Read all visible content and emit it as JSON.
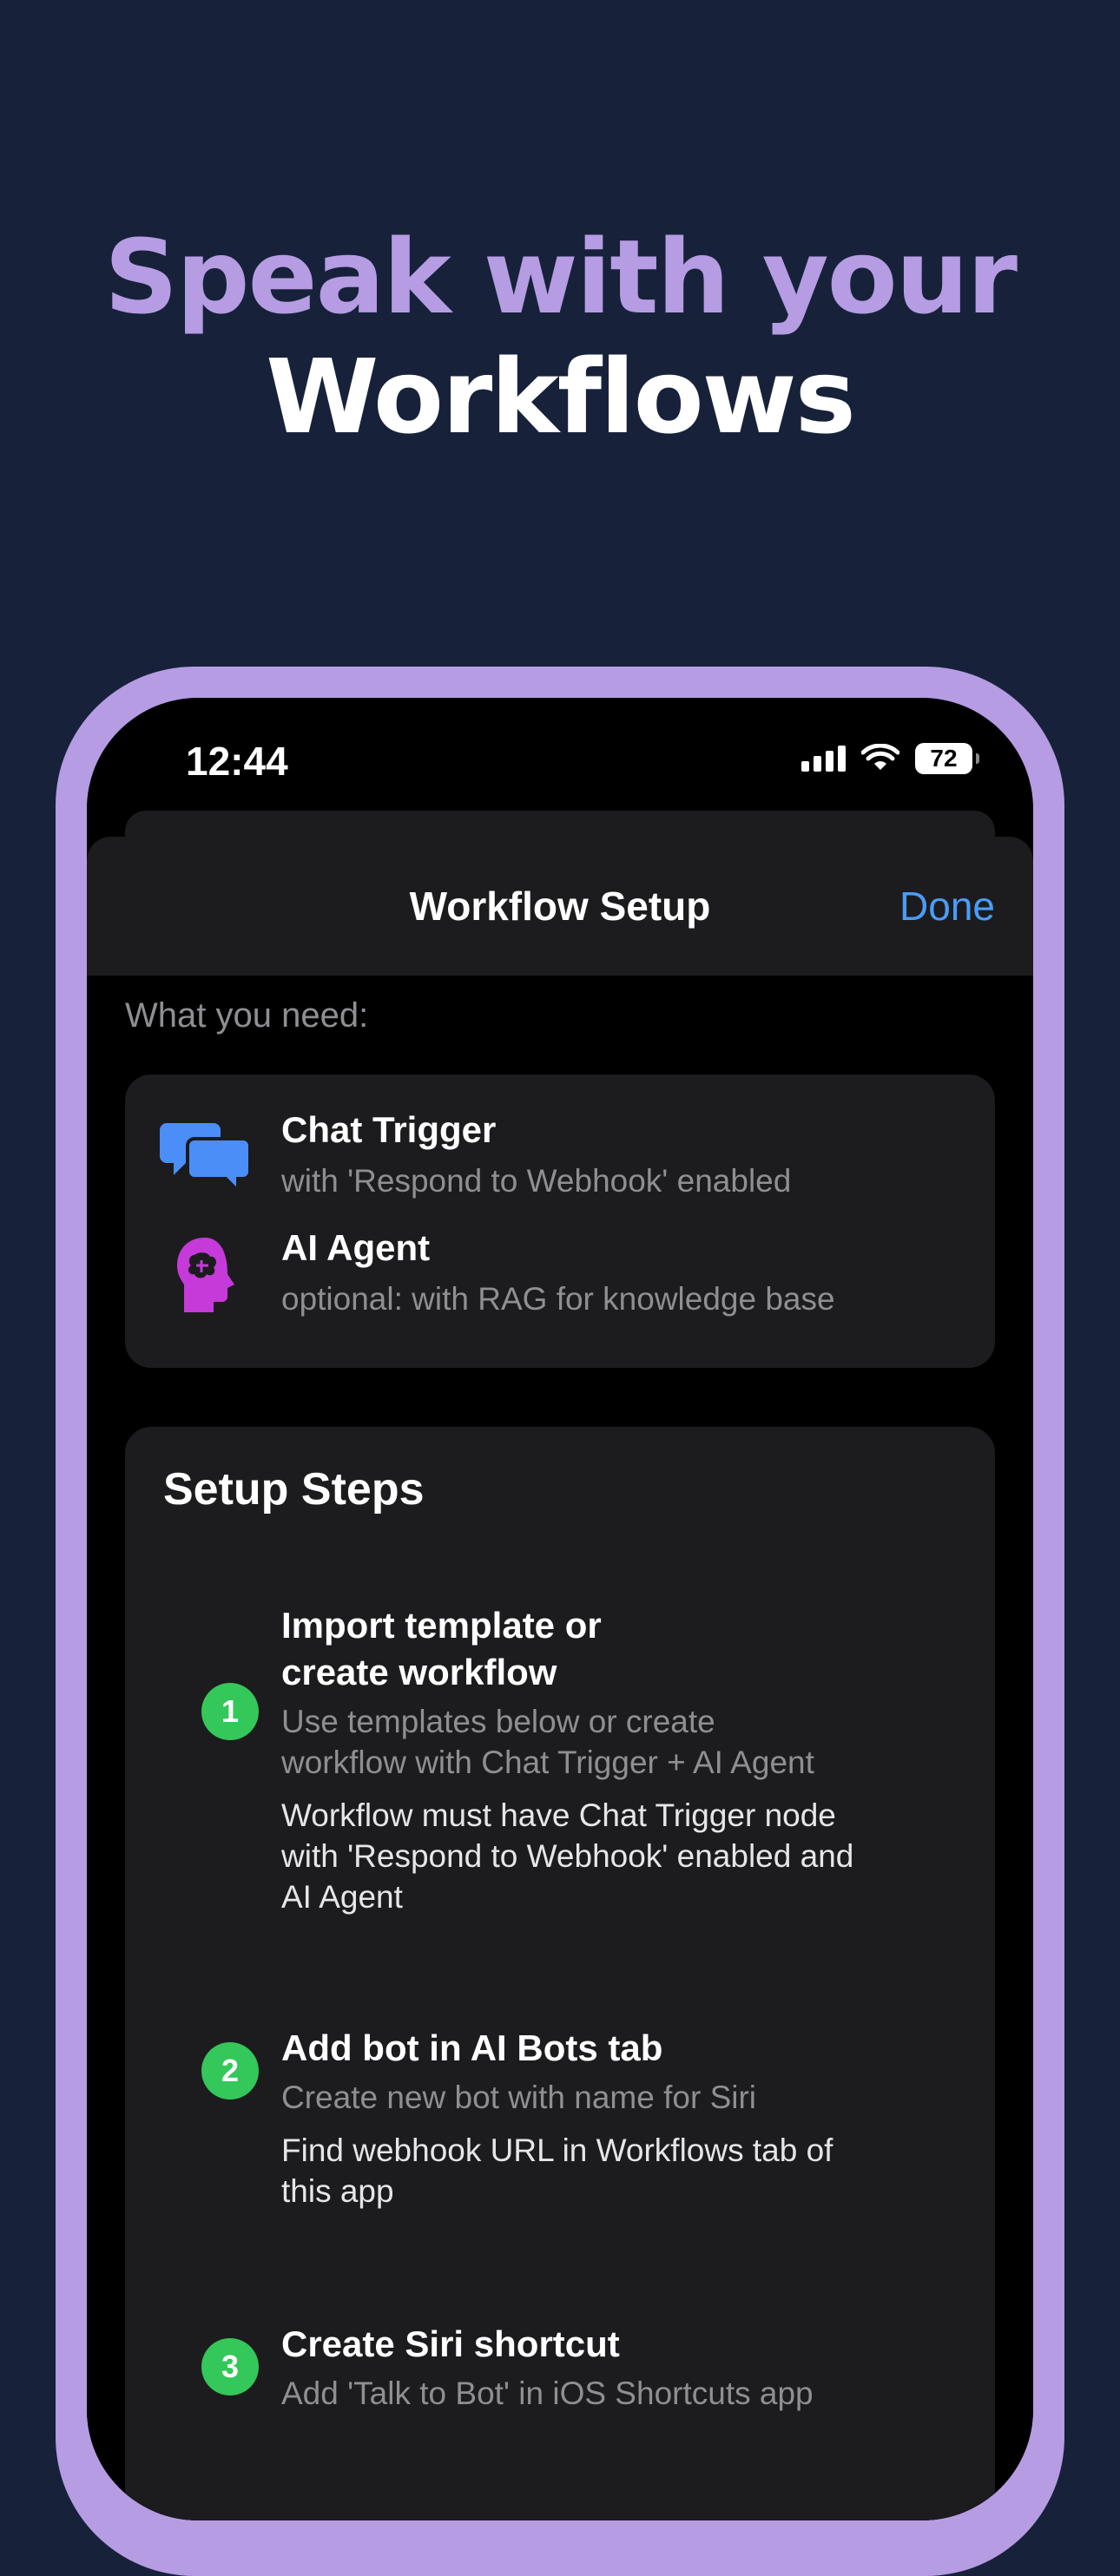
{
  "headline": {
    "line1": "Speak with your",
    "line2": "Workflows"
  },
  "status_bar": {
    "time": "12:44",
    "battery": "72"
  },
  "nav": {
    "title": "Workflow Setup",
    "done_label": "Done"
  },
  "requirements": {
    "header": "What you need:",
    "items": [
      {
        "icon": "chat-bubbles-icon",
        "title": "Chat Trigger",
        "subtitle": "with 'Respond to Webhook' enabled"
      },
      {
        "icon": "brain-head-icon",
        "title": "AI Agent",
        "subtitle": "optional: with RAG for knowledge base"
      }
    ]
  },
  "setup": {
    "title": "Setup Steps",
    "steps": [
      {
        "number": "1",
        "title": "Import template or\ncreate workflow",
        "subtitle": "Use templates below or create\nworkflow with Chat Trigger + AI Agent",
        "note": "Workflow must have Chat Trigger node\nwith 'Respond to Webhook' enabled and\nAI Agent"
      },
      {
        "number": "2",
        "title": "Add bot in AI Bots tab",
        "subtitle": "Create new bot with name for Siri",
        "note": "Find webhook URL in Workflows tab of\nthis app"
      },
      {
        "number": "3",
        "title": "Create Siri shortcut",
        "subtitle": "Add 'Talk to Bot' in iOS Shortcuts app",
        "note": ""
      }
    ]
  },
  "colors": {
    "background": "#17223a",
    "accent_purple": "#b59ce3",
    "link_blue": "#4b9cf8",
    "step_green": "#34c759",
    "chat_icon_blue": "#4b8ef7",
    "brain_icon_magenta": "#c53ad9"
  }
}
